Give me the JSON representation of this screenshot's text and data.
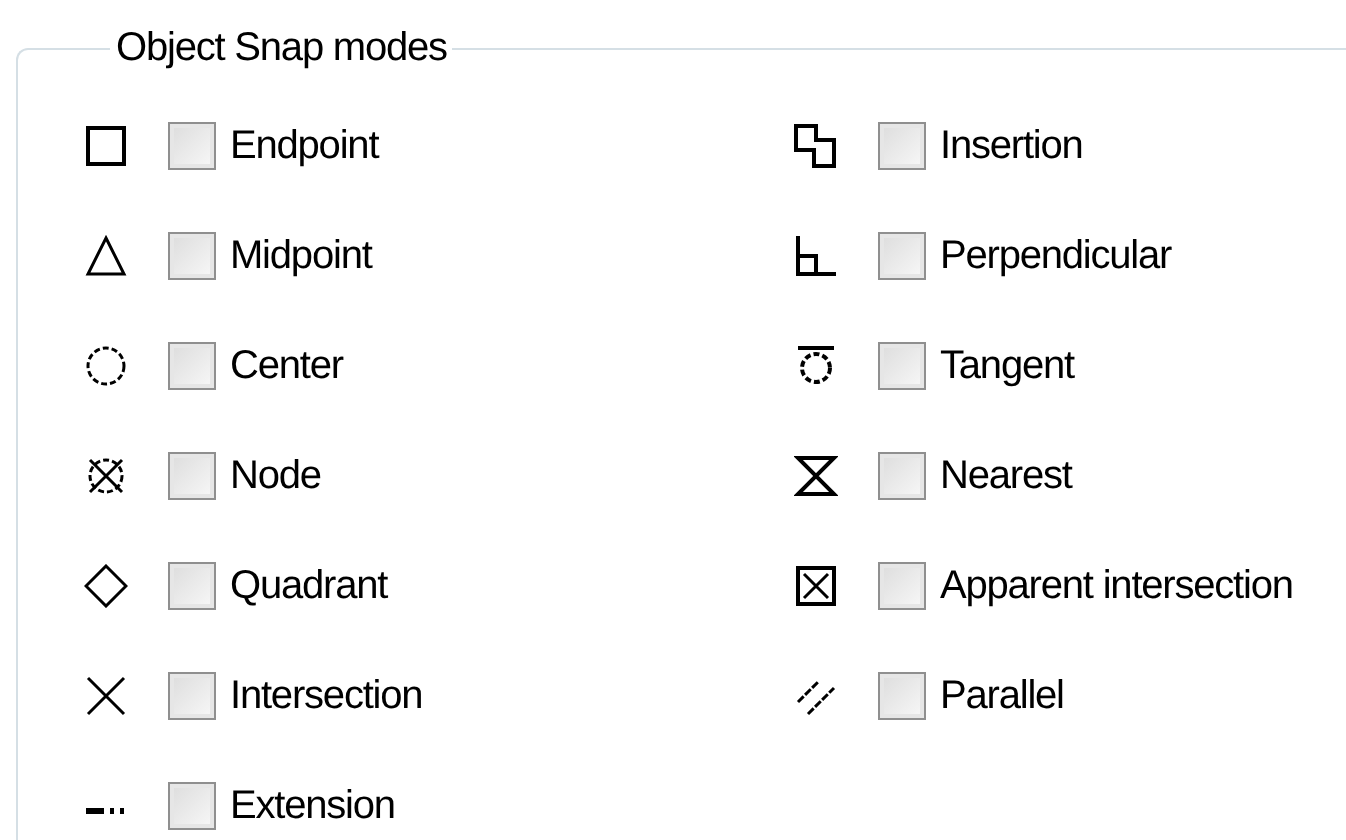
{
  "group": {
    "title": "Object Snap modes"
  },
  "columns": [
    [
      {
        "kind": "endpoint",
        "label": "Endpoint",
        "checked": false
      },
      {
        "kind": "midpoint",
        "label": "Midpoint",
        "checked": false
      },
      {
        "kind": "center",
        "label": "Center",
        "checked": false
      },
      {
        "kind": "node",
        "label": "Node",
        "checked": false
      },
      {
        "kind": "quadrant",
        "label": "Quadrant",
        "checked": false
      },
      {
        "kind": "intersection",
        "label": "Intersection",
        "checked": false
      },
      {
        "kind": "extension",
        "label": "Extension",
        "checked": false
      }
    ],
    [
      {
        "kind": "insertion",
        "label": "Insertion",
        "checked": false
      },
      {
        "kind": "perpendicular",
        "label": "Perpendicular",
        "checked": false
      },
      {
        "kind": "tangent",
        "label": "Tangent",
        "checked": false
      },
      {
        "kind": "nearest",
        "label": "Nearest",
        "checked": false
      },
      {
        "kind": "apparent",
        "label": "Apparent intersection",
        "checked": false
      },
      {
        "kind": "parallel",
        "label": "Parallel",
        "checked": false
      }
    ]
  ]
}
